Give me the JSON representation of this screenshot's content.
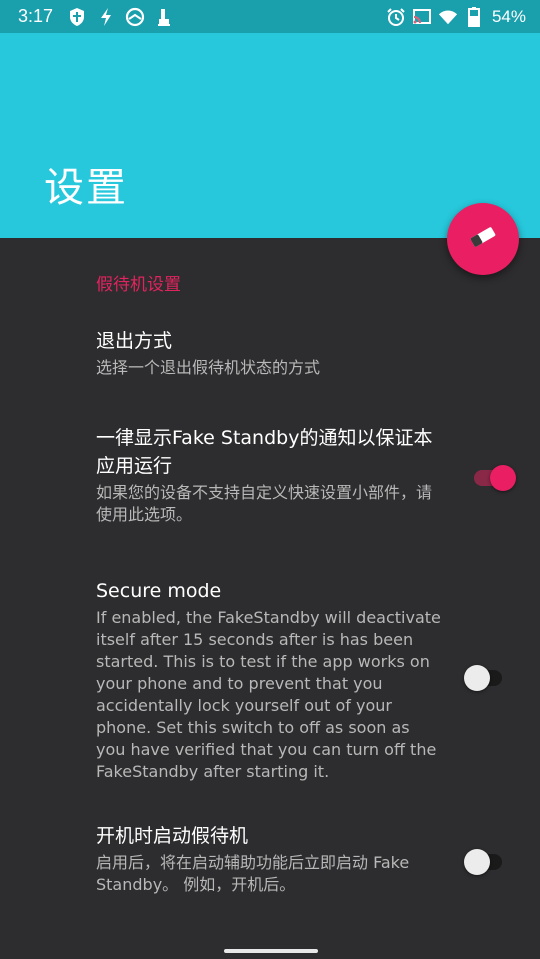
{
  "status_bar": {
    "time": "3:17",
    "battery": "54%",
    "left_icons": [
      "shield-icon",
      "flash-icon",
      "vpn-icon",
      "usb-icon"
    ],
    "right_icons": [
      "alarm-icon",
      "cast-icon",
      "wifi-icon",
      "battery-icon"
    ]
  },
  "app_bar": {
    "title": "设置",
    "color": "#27c8dc"
  },
  "fab": {
    "icon": "eraser-icon",
    "color": "#e91e63"
  },
  "category": {
    "label": "假待机设置",
    "color": "#e0245e"
  },
  "preferences": [
    {
      "title": "退出方式",
      "summary": "选择一个退出假待机状态的方式"
    },
    {
      "title": "一律显示Fake Standby的通知以保证本应用运行",
      "summary": "如果您的设备不支持自定义快速设置小部件，请使用此选项。",
      "switch": "on"
    },
    {
      "title": "Secure mode",
      "summary": "If enabled, the FakeStandby will deactivate itself after 15 seconds after is has been started. This is to test if the app works on your phone and to prevent that you accidentally lock yourself out of your phone. Set this switch to off as soon as you have verified that you can turn off the FakeStandby after starting it.",
      "switch": "off"
    },
    {
      "title": "开机时启动假待机",
      "summary": "启用后，将在启动辅助功能后立即启动 Fake Standby。 例如，开机后。",
      "switch": "off"
    }
  ]
}
